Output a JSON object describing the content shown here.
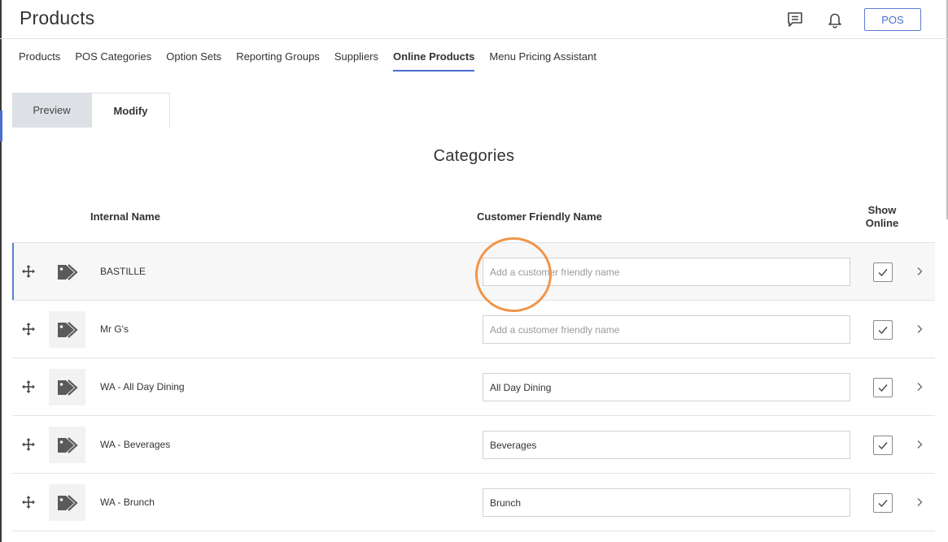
{
  "header": {
    "title": "Products",
    "chat_icon": "chat-icon",
    "bell_icon": "bell-icon",
    "pos_label": "POS"
  },
  "nav": {
    "items": [
      {
        "label": "Products",
        "active": false
      },
      {
        "label": "POS Categories",
        "active": false
      },
      {
        "label": "Option Sets",
        "active": false
      },
      {
        "label": "Reporting Groups",
        "active": false
      },
      {
        "label": "Suppliers",
        "active": false
      },
      {
        "label": "Online Products",
        "active": true
      },
      {
        "label": "Menu Pricing Assistant",
        "active": false
      }
    ]
  },
  "tabs": {
    "preview": "Preview",
    "modify": "Modify",
    "active": "Modify"
  },
  "section": {
    "title": "Categories"
  },
  "columns": {
    "internal_name": "Internal Name",
    "friendly_name": "Customer Friendly Name",
    "show_online": "Show Online"
  },
  "rows": [
    {
      "internal_name": "BASTILLE",
      "friendly_value": "",
      "placeholder": "Add a customer friendly name",
      "show_online": true
    },
    {
      "internal_name": "Mr G's",
      "friendly_value": "",
      "placeholder": "Add a customer friendly name",
      "show_online": true
    },
    {
      "internal_name": "WA - All Day Dining",
      "friendly_value": "All Day Dining",
      "placeholder": "Add a customer friendly name",
      "show_online": true
    },
    {
      "internal_name": "WA - Beverages",
      "friendly_value": "Beverages",
      "placeholder": "Add a customer friendly name",
      "show_online": true
    },
    {
      "internal_name": "WA - Brunch",
      "friendly_value": "Brunch",
      "placeholder": "Add a customer friendly name",
      "show_online": true
    }
  ],
  "colors": {
    "accent": "#4a6fd1",
    "highlight": "#f0954a"
  }
}
